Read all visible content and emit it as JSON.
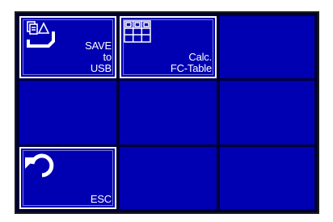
{
  "menu": {
    "save_usb": {
      "line1": "SAVE",
      "line2": "to",
      "line3": "USB",
      "icon": "file-save-usb-icon"
    },
    "calc_fc": {
      "line1": "Calc.",
      "line2": "FC-Table",
      "icon": "table-grid-icon"
    },
    "esc": {
      "label": "ESC",
      "icon": "undo-arrow-icon"
    }
  },
  "colors": {
    "cell": "#0000b2",
    "grid": "#000033",
    "text": "#ffffff"
  }
}
